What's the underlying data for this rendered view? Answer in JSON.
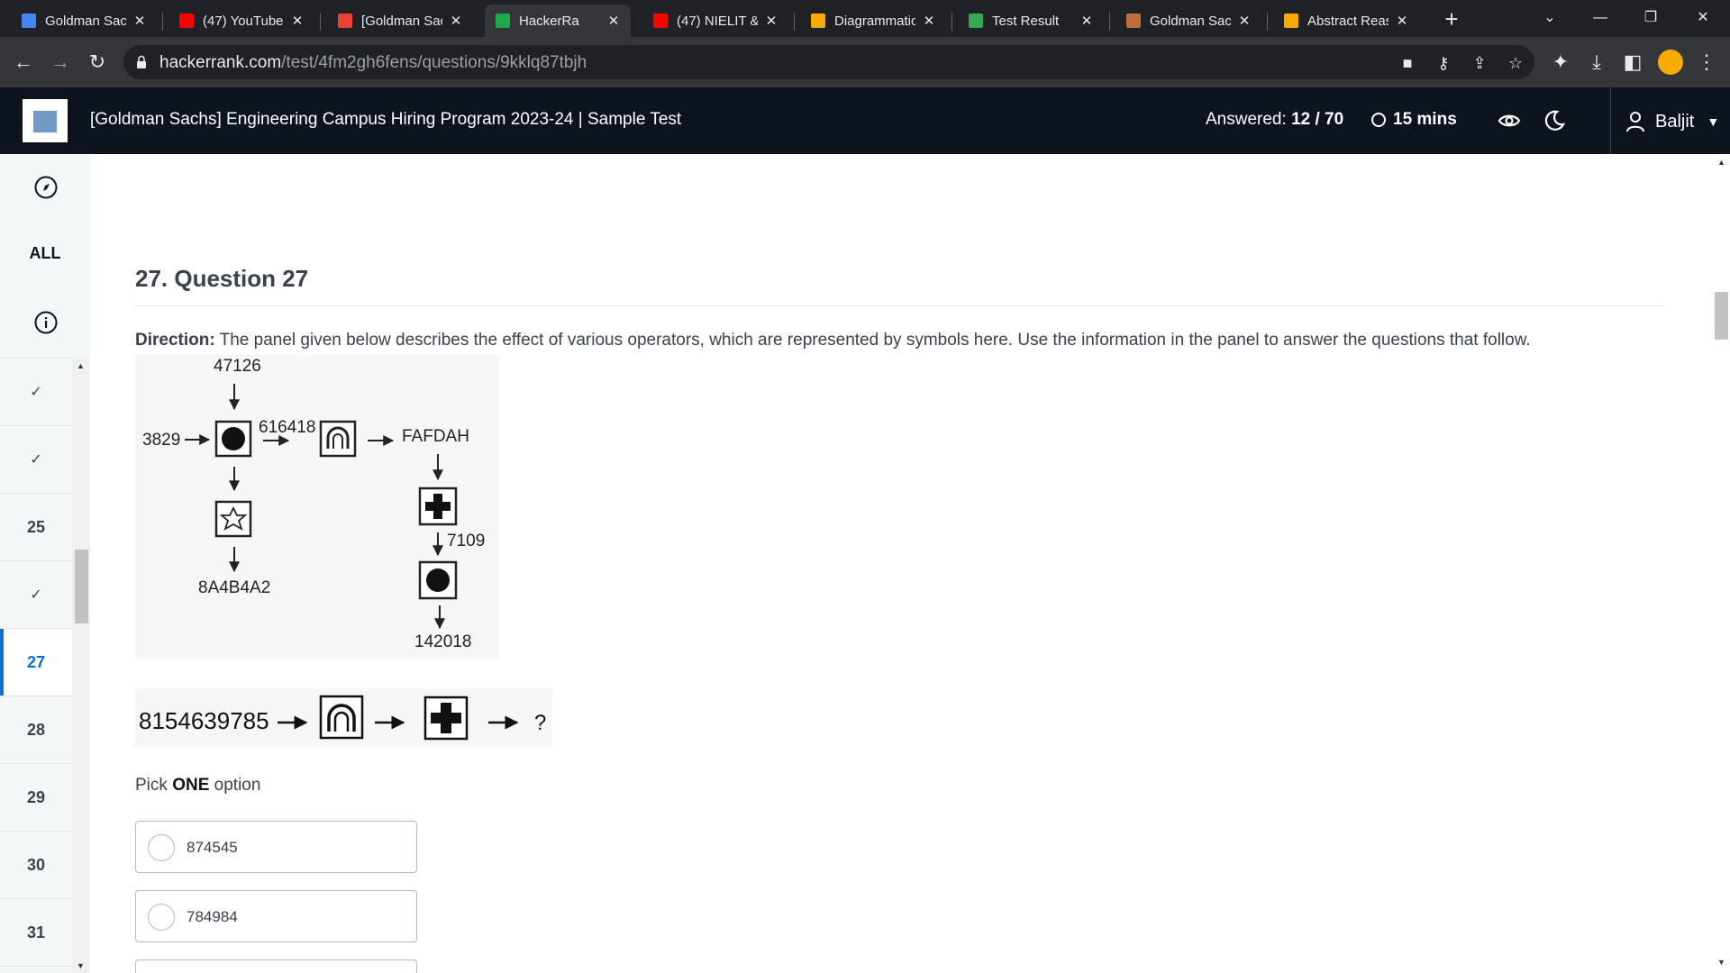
{
  "browser": {
    "tabs": [
      {
        "title": "Goldman Sach",
        "favicon": "docs-icon",
        "color": "#4285f4"
      },
      {
        "title": "(47) YouTube",
        "favicon": "youtube-icon",
        "color": "#ff0000"
      },
      {
        "title": "[Goldman Sac",
        "favicon": "gmail-icon",
        "color": "#ea4335"
      },
      {
        "title": "HackerRa",
        "favicon": "hackerrank-icon",
        "color": "#1ba94c",
        "active": true
      },
      {
        "title": "(47) NIELIT &",
        "favicon": "youtube-icon",
        "color": "#ff0000"
      },
      {
        "title": "Diagrammatic",
        "favicon": "warning-icon",
        "color": "#f9ab00"
      },
      {
        "title": "Test Result",
        "favicon": "result-icon",
        "color": "#34a853"
      },
      {
        "title": "Goldman Sac",
        "favicon": "mascot-icon",
        "color": "#c26b3d"
      },
      {
        "title": "Abstract Reas",
        "favicon": "warning-icon",
        "color": "#f9ab00"
      }
    ],
    "url_host": "hackerrank.com",
    "url_path": "/test/4fm2gh6fens/questions/9kklq87tbjh"
  },
  "header": {
    "title": "[Goldman Sachs] Engineering Campus Hiring Program 2023-24 | Sample Test",
    "answered_label": "Answered:",
    "answered_value": "12 / 70",
    "timer": "15 mins",
    "user": "Baljit"
  },
  "sidebar": {
    "all_label": "ALL",
    "items": [
      {
        "label": "",
        "answered": true
      },
      {
        "label": "",
        "answered": true
      },
      {
        "label": "25",
        "answered": false
      },
      {
        "label": "",
        "answered": true
      },
      {
        "label": "27",
        "answered": false,
        "current": true
      },
      {
        "label": "28",
        "answered": false
      },
      {
        "label": "29",
        "answered": false
      },
      {
        "label": "30",
        "answered": false
      },
      {
        "label": "31",
        "answered": false
      }
    ]
  },
  "question": {
    "title": "27. Question 27",
    "direction_label": "Direction:",
    "direction_text": " The panel given below describes the effect of various operators, which are represented by symbols here. Use the information in the panel to answer the questions that follow.",
    "panel": {
      "top_input": "47126",
      "left_input": "3829",
      "mid_value": "616418",
      "right_output": "FAFDAH",
      "bottom_left": "8A4B4A2",
      "right_mid": "7109",
      "bottom_right": "142018"
    },
    "problem": {
      "input": "8154639785",
      "result": "?"
    },
    "pick_prefix": "Pick ",
    "pick_strong": "ONE",
    "pick_suffix": " option",
    "options": [
      "874545",
      "784984"
    ]
  }
}
